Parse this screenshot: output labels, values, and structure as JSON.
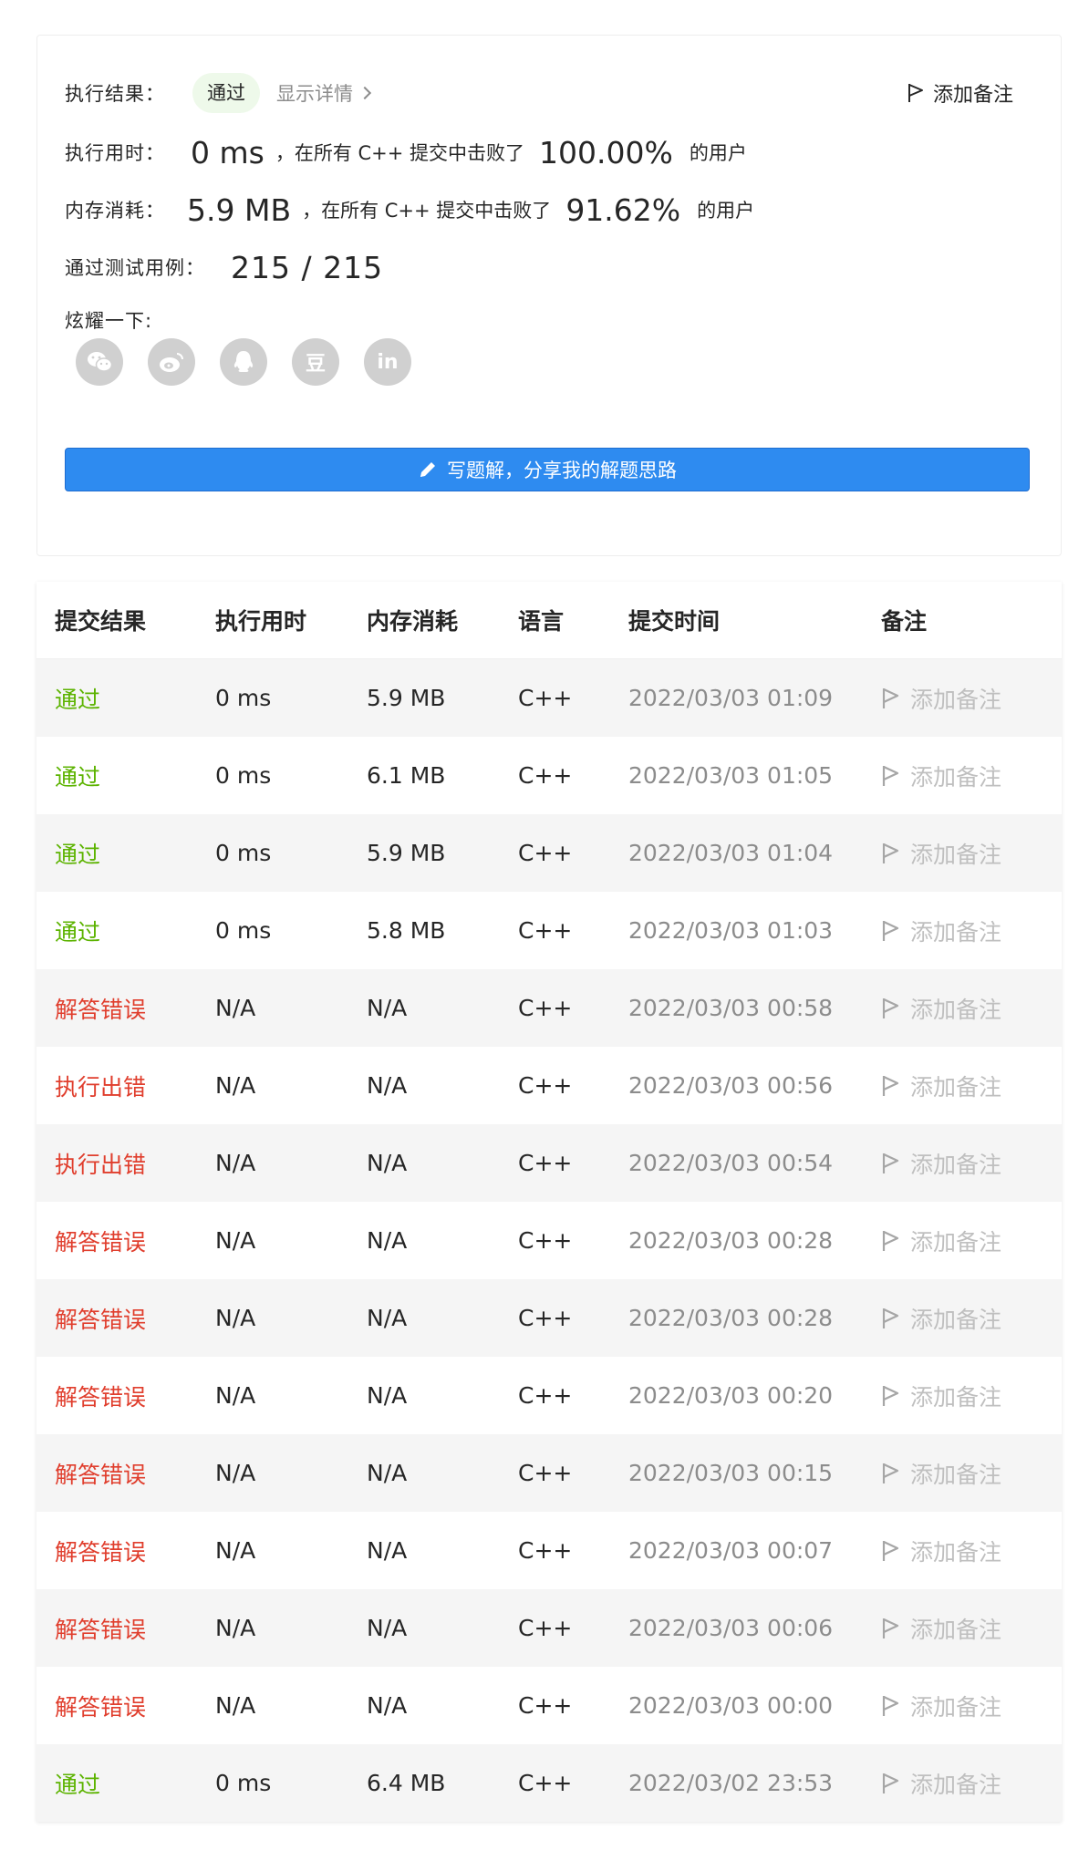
{
  "result_card": {
    "status_label": "执行结果：",
    "status_value": "通过",
    "show_details": "显示详情",
    "add_note": "添加备注",
    "runtime_label": "执行用时：",
    "runtime_value": "0 ms",
    "runtime_text": "，在所有 C++ 提交中击败了",
    "runtime_percent": "100.00%",
    "runtime_suffix": "的用户",
    "memory_label": "内存消耗：",
    "memory_value": "5.9 MB",
    "memory_text": "，在所有 C++ 提交中击败了",
    "memory_percent": "91.62%",
    "memory_suffix": "的用户",
    "tests_label": "通过测试用例：",
    "tests_value": "215 / 215",
    "share_label": "炫耀一下:",
    "share_icons": [
      "wechat-icon",
      "weibo-icon",
      "qq-icon",
      "douban-icon",
      "linkedin-icon"
    ],
    "share_glyphs": {
      "douban": "豆",
      "linkedin": "in"
    },
    "write_solution": "写题解，分享我的解题思路"
  },
  "table": {
    "headers": [
      "提交结果",
      "执行用时",
      "内存消耗",
      "语言",
      "提交时间",
      "备注"
    ],
    "rows": [
      {
        "result": "通过",
        "status": "ok",
        "runtime": "0 ms",
        "memory": "5.9 MB",
        "lang": "C++",
        "time": "2022/03/03 01:09",
        "note": "添加备注"
      },
      {
        "result": "通过",
        "status": "ok",
        "runtime": "0 ms",
        "memory": "6.1 MB",
        "lang": "C++",
        "time": "2022/03/03 01:05",
        "note": "添加备注"
      },
      {
        "result": "通过",
        "status": "ok",
        "runtime": "0 ms",
        "memory": "5.9 MB",
        "lang": "C++",
        "time": "2022/03/03 01:04",
        "note": "添加备注"
      },
      {
        "result": "通过",
        "status": "ok",
        "runtime": "0 ms",
        "memory": "5.8 MB",
        "lang": "C++",
        "time": "2022/03/03 01:03",
        "note": "添加备注"
      },
      {
        "result": "解答错误",
        "status": "err",
        "runtime": "N/A",
        "memory": "N/A",
        "lang": "C++",
        "time": "2022/03/03 00:58",
        "note": "添加备注"
      },
      {
        "result": "执行出错",
        "status": "err",
        "runtime": "N/A",
        "memory": "N/A",
        "lang": "C++",
        "time": "2022/03/03 00:56",
        "note": "添加备注"
      },
      {
        "result": "执行出错",
        "status": "err",
        "runtime": "N/A",
        "memory": "N/A",
        "lang": "C++",
        "time": "2022/03/03 00:54",
        "note": "添加备注"
      },
      {
        "result": "解答错误",
        "status": "err",
        "runtime": "N/A",
        "memory": "N/A",
        "lang": "C++",
        "time": "2022/03/03 00:28",
        "note": "添加备注"
      },
      {
        "result": "解答错误",
        "status": "err",
        "runtime": "N/A",
        "memory": "N/A",
        "lang": "C++",
        "time": "2022/03/03 00:28",
        "note": "添加备注"
      },
      {
        "result": "解答错误",
        "status": "err",
        "runtime": "N/A",
        "memory": "N/A",
        "lang": "C++",
        "time": "2022/03/03 00:20",
        "note": "添加备注"
      },
      {
        "result": "解答错误",
        "status": "err",
        "runtime": "N/A",
        "memory": "N/A",
        "lang": "C++",
        "time": "2022/03/03 00:15",
        "note": "添加备注"
      },
      {
        "result": "解答错误",
        "status": "err",
        "runtime": "N/A",
        "memory": "N/A",
        "lang": "C++",
        "time": "2022/03/03 00:07",
        "note": "添加备注"
      },
      {
        "result": "解答错误",
        "status": "err",
        "runtime": "N/A",
        "memory": "N/A",
        "lang": "C++",
        "time": "2022/03/03 00:06",
        "note": "添加备注"
      },
      {
        "result": "解答错误",
        "status": "err",
        "runtime": "N/A",
        "memory": "N/A",
        "lang": "C++",
        "time": "2022/03/03 00:00",
        "note": "添加备注"
      },
      {
        "result": "通过",
        "status": "ok",
        "runtime": "0 ms",
        "memory": "6.4 MB",
        "lang": "C++",
        "time": "2022/03/02 23:53",
        "note": "添加备注"
      }
    ]
  },
  "colors": {
    "accepted": "#5cb300",
    "error": "#e03e2d",
    "button": "#2e8bf0",
    "muted": "#8c8c8c"
  }
}
